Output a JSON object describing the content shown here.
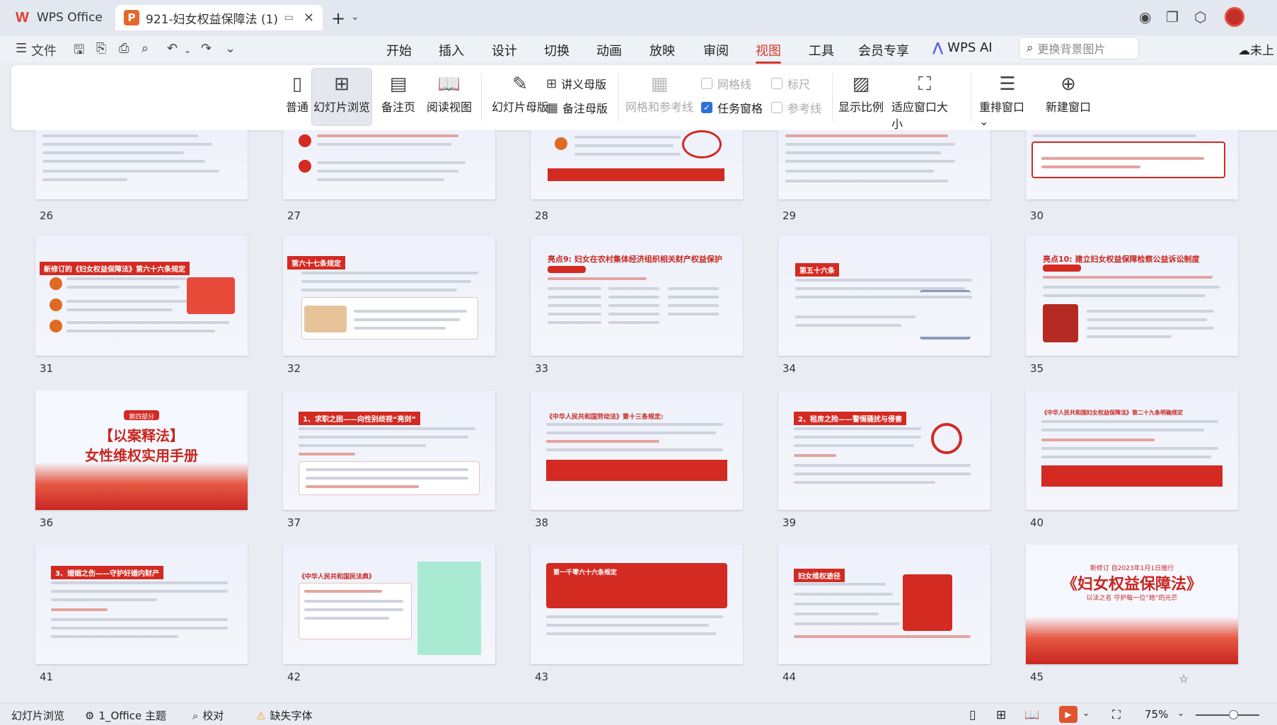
{
  "titlebar": {
    "app_tab": "WPS Office",
    "doc_tab": "921-妇女权益保障法 (1).ppt",
    "right_icons": [
      "copilot-icon",
      "window-icon",
      "cube-icon",
      "user-avatar"
    ]
  },
  "menubar": {
    "file": "文件",
    "tabs": [
      "开始",
      "插入",
      "设计",
      "切换",
      "动画",
      "放映",
      "审阅",
      "视图",
      "工具",
      "会员专享"
    ],
    "active_tab": "视图",
    "wps_ai": "WPS AI",
    "search_placeholder": "更换背景图片",
    "cloud_label": "未上"
  },
  "ribbon": {
    "normal": "普通",
    "slide_sorter": "幻灯片浏览",
    "notes_page": "备注页",
    "reading_view": "阅读视图",
    "slide_master": "幻灯片母版",
    "handout_master": "讲义母版",
    "notes_master": "备注母版",
    "grid_guides": "网格和参考线",
    "gridlines": "网格线",
    "ruler": "标尺",
    "task_pane": "任务窗格",
    "guides": "参考线",
    "zoom": "显示比例",
    "fit_window": "适应窗口大小",
    "arrange": "重排窗口",
    "new_window": "新建窗口"
  },
  "slides": {
    "row0": [
      "26",
      "27",
      "28",
      "29",
      "30"
    ],
    "row1": [
      "31",
      "32",
      "33",
      "34",
      "35"
    ],
    "row2": [
      "36",
      "37",
      "38",
      "39",
      "40"
    ],
    "row3": [
      "41",
      "42",
      "43",
      "44",
      "45"
    ],
    "titles": {
      "s31": "新修订的《妇女权益保障法》第六十六条规定",
      "s32": "第六十七条规定",
      "s33": "亮点9: 妇女在农村集体经济组织相关财产权益保护",
      "s34": "第五十六条",
      "s35": "亮点10: 建立妇女权益保障检察公益诉讼制度",
      "s36_top": "第四部分",
      "s36_title": "【以案释法】",
      "s36_sub": "女性维权实用手册",
      "s37": "1、求职之困——向性别歧视“亮剑”",
      "s38": "《中华人民共和国劳动法》第十三条规定:",
      "s39": "2、租房之险——警惕骚扰与侵害",
      "s40": "《中华人民共和国妇女权益保障法》第二十九条明确规定",
      "s41": "3、婚姻之伤——守护好婚内财产",
      "s42": "《中华人民共和国民法典》",
      "s43": "第一千零六十六条规定",
      "s44": "妇女维权途径",
      "s45_top": "新修订 自2023年1月1日施行",
      "s45_title": "《妇女权益保障法》",
      "s45_sub": "以法之名 守护每一位“她”的光芒"
    }
  },
  "statusbar": {
    "view": "幻灯片浏览",
    "theme": "1_Office 主题",
    "proof": "校对",
    "missing_font": "缺失字体",
    "zoom": "75%"
  }
}
